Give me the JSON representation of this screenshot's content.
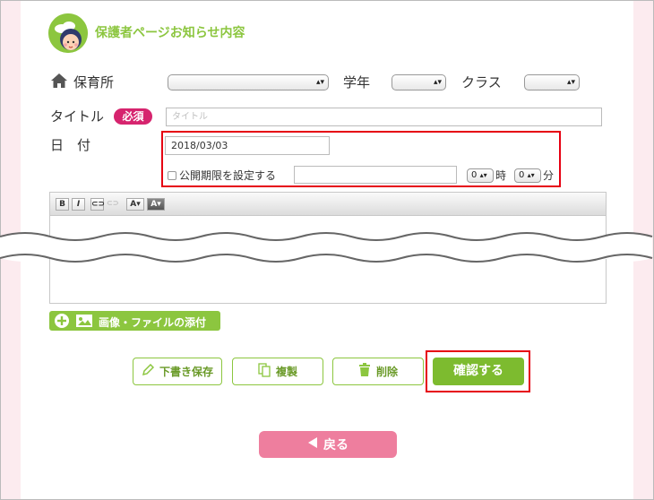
{
  "header": {
    "title": "保護者ページお知らせ内容",
    "logo_icon": "child-avatar-icon"
  },
  "filters": {
    "nursery_label": "保育所",
    "grade_label": "学年",
    "class_label": "クラス",
    "nursery_value": "",
    "grade_value": "",
    "class_value": ""
  },
  "form": {
    "title_label": "タイトル",
    "required_badge": "必須",
    "title_placeholder": "タイトル",
    "date_label": "日　付",
    "date_value": "2018/03/03",
    "expiry_checkbox_label": "公開期限を設定する",
    "expiry_date_value": "",
    "hour_value": "0",
    "hour_unit": "時",
    "minute_value": "0",
    "minute_unit": "分"
  },
  "editor": {
    "bold": "B",
    "italic": "I",
    "font_color": "A",
    "bg_color": "A"
  },
  "attach": {
    "label": "画像・ファイルの添付"
  },
  "actions": {
    "draft_label": "下書き保存",
    "copy_label": "複製",
    "delete_label": "削除",
    "confirm_label": "確認する",
    "back_label": "戻る"
  },
  "colors": {
    "accent": "#8cc63f",
    "required": "#d6246e",
    "back": "#ee7e9e",
    "highlight": "#e60012"
  }
}
